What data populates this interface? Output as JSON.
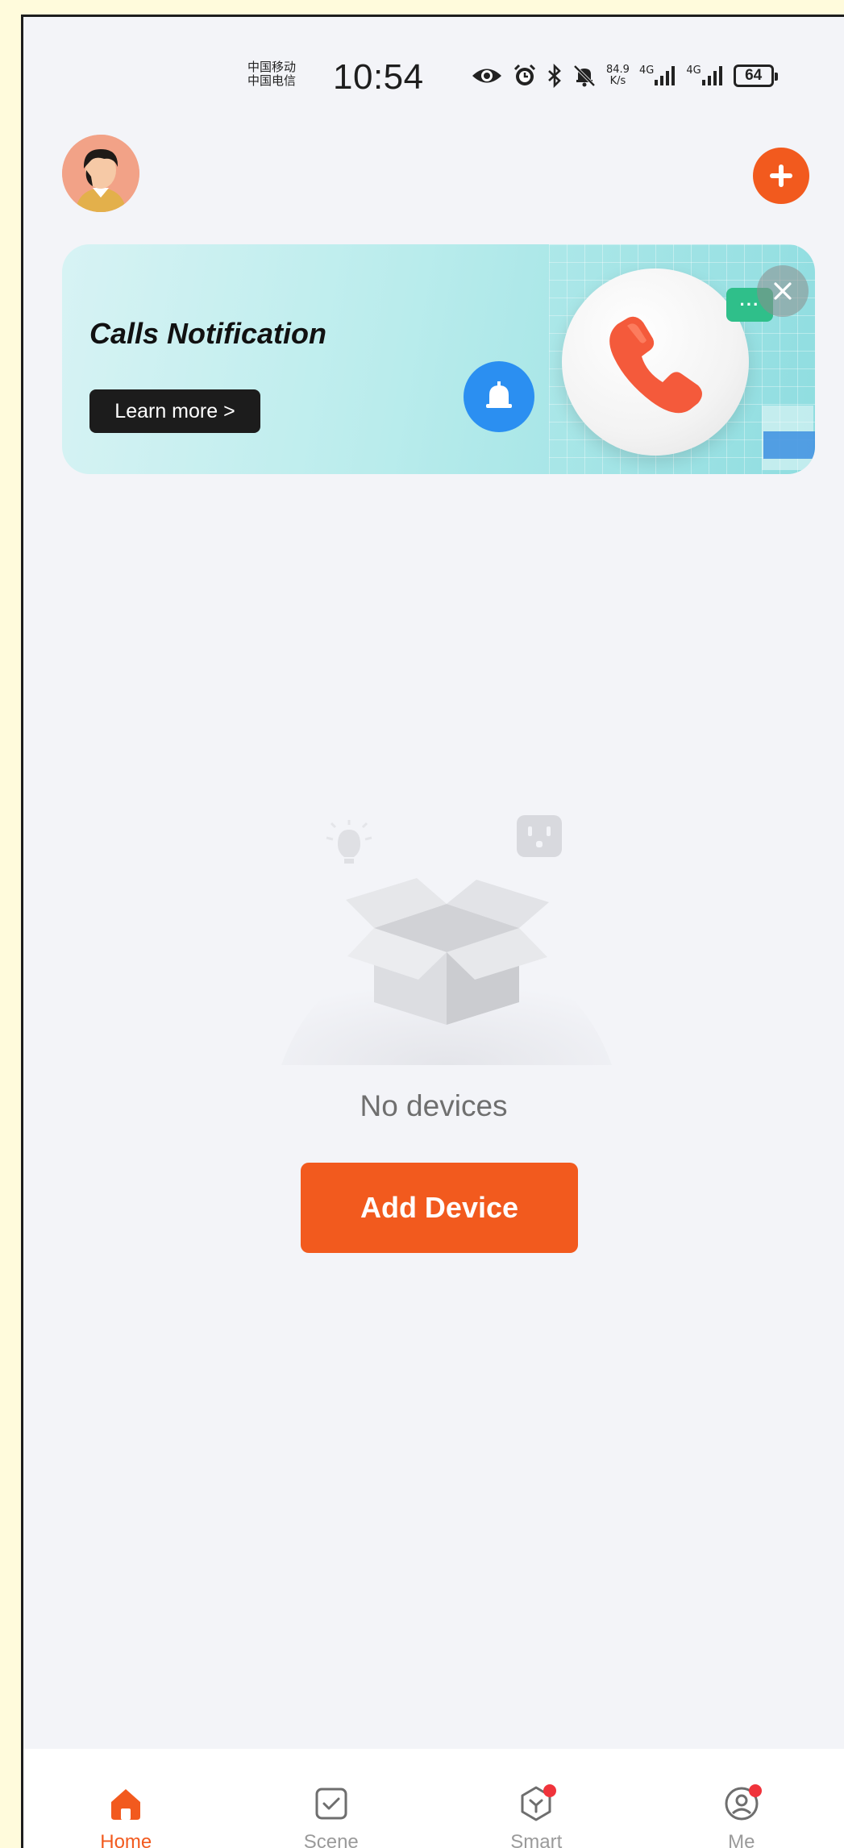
{
  "status_bar": {
    "carrier_line1": "中国移动",
    "carrier_line2": "中国电信",
    "time": "10:54",
    "speed_value": "84.9",
    "speed_unit": "K/s",
    "network1": "4G",
    "network2": "4G",
    "battery": "64",
    "icons": [
      "eye-icon",
      "alarm-icon",
      "bluetooth-icon",
      "mute-icon",
      "signal-icon",
      "signal-icon"
    ]
  },
  "header": {
    "avatar": "user-avatar",
    "add_icon": "plus-icon"
  },
  "banner": {
    "title": "Calls Notification",
    "learn_more": "Learn more >",
    "close_icon": "close-icon",
    "alarm_icon": "alarm-bell-icon",
    "phone_icon": "phone-icon",
    "chat_text": "···"
  },
  "empty_state": {
    "illustration": "empty-box-icon",
    "message": "No devices",
    "add_device_label": "Add Device"
  },
  "bottom_nav": {
    "items": [
      {
        "label": "Home",
        "icon": "home-icon",
        "active": true,
        "badge": false
      },
      {
        "label": "Scene",
        "icon": "scene-icon",
        "active": false,
        "badge": false
      },
      {
        "label": "Smart",
        "icon": "smart-icon",
        "active": false,
        "badge": true
      },
      {
        "label": "Me",
        "icon": "profile-icon",
        "active": false,
        "badge": true
      }
    ]
  },
  "colors": {
    "accent": "#f25a1e",
    "badge": "#f0333b",
    "background": "#f3f4f8",
    "banner": "#b9ecec"
  }
}
